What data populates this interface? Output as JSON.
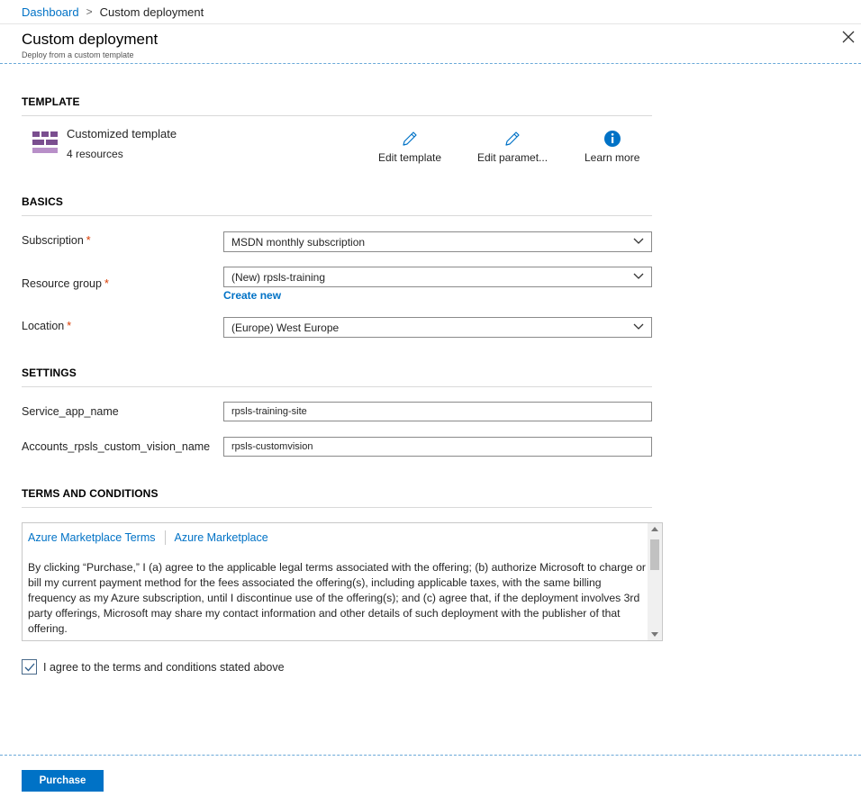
{
  "breadcrumb": {
    "home": "Dashboard",
    "separator": ">",
    "current": "Custom deployment"
  },
  "blade": {
    "title": "Custom deployment",
    "subtitle": "Deploy from a custom template"
  },
  "template_section": {
    "title": "TEMPLATE",
    "icon": "template-grid-icon",
    "name": "Customized template",
    "resources": "4 resources",
    "actions": [
      {
        "label": "Edit template",
        "icon": "pencil-icon"
      },
      {
        "label": "Edit paramet...",
        "icon": "pencil-icon"
      },
      {
        "label": "Learn more",
        "icon": "info-icon"
      }
    ]
  },
  "basics": {
    "title": "BASICS",
    "subscription": {
      "label": "Subscription",
      "required": "*",
      "value": "MSDN monthly subscription"
    },
    "resource_group": {
      "label": "Resource group",
      "required": "*",
      "value": "(New) rpsls-training",
      "create_new": "Create new"
    },
    "location": {
      "label": "Location",
      "required": "*",
      "value": "(Europe) West Europe"
    }
  },
  "settings": {
    "title": "SETTINGS",
    "service_app_name": {
      "label": "Service_app_name",
      "value": "rpsls-training-site"
    },
    "custom_vision_name": {
      "label": "Accounts_rpsls_custom_vision_name",
      "value": "rpsls-customvision"
    }
  },
  "terms": {
    "title": "TERMS AND CONDITIONS",
    "link1": "Azure Marketplace Terms",
    "link2": "Azure Marketplace",
    "body": "By clicking “Purchase,” I (a) agree to the applicable legal terms associated with the offering; (b) authorize Microsoft to charge or bill my current payment method for the fees associated the offering(s), including applicable taxes, with the same billing frequency as my Azure subscription, until I discontinue use of the offering(s); and (c) agree that, if the deployment involves 3rd party offerings, Microsoft may share my contact information and other details of such deployment with the publisher of that offering.",
    "agree_label": "I agree to the terms and conditions stated above",
    "agree_checked": true
  },
  "footer": {
    "purchase_label": "Purchase"
  },
  "colors": {
    "accent": "#0072c6",
    "required": "#d83b01",
    "template_icon": "#7a4e8f"
  }
}
